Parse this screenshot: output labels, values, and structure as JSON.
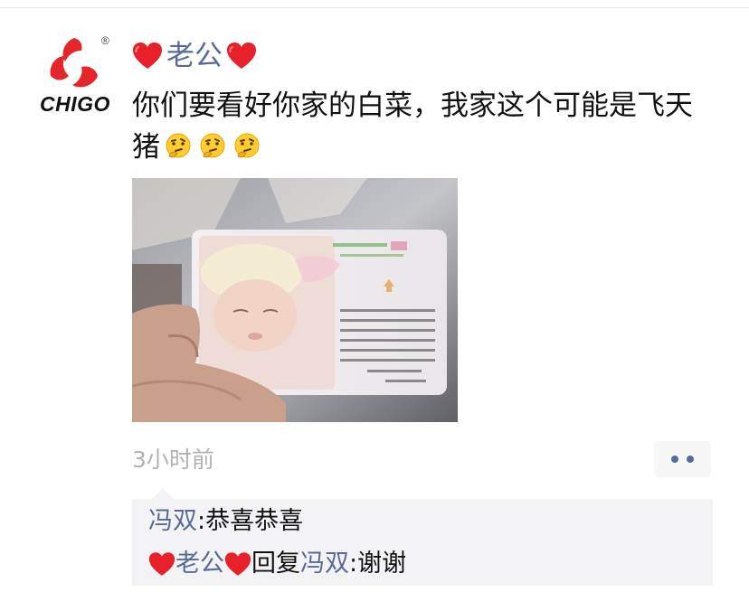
{
  "post": {
    "author": {
      "name": "老公",
      "avatar_text": "CHIGO",
      "avatar_reg": "®",
      "decorations": [
        "red-heart-icon",
        "red-heart-icon"
      ]
    },
    "text": "你们要看好你家的白菜，我家这个可能是飞天猪",
    "emojis": [
      "thinking-face-icon",
      "thinking-face-icon",
      "thinking-face-icon"
    ],
    "time": "3小时前",
    "more_button": "more-options-icon"
  },
  "comments": [
    {
      "author": "冯双",
      "separator": ": ",
      "text": "恭喜恭喜"
    },
    {
      "author": "老公",
      "reply_word": "回复",
      "reply_to": "冯双",
      "separator": ": ",
      "text": "谢谢"
    }
  ],
  "colors": {
    "link": "#576b95",
    "time": "#b2b2b2",
    "comment_bg": "#f3f3f5",
    "logo_red": "#e4262c"
  }
}
